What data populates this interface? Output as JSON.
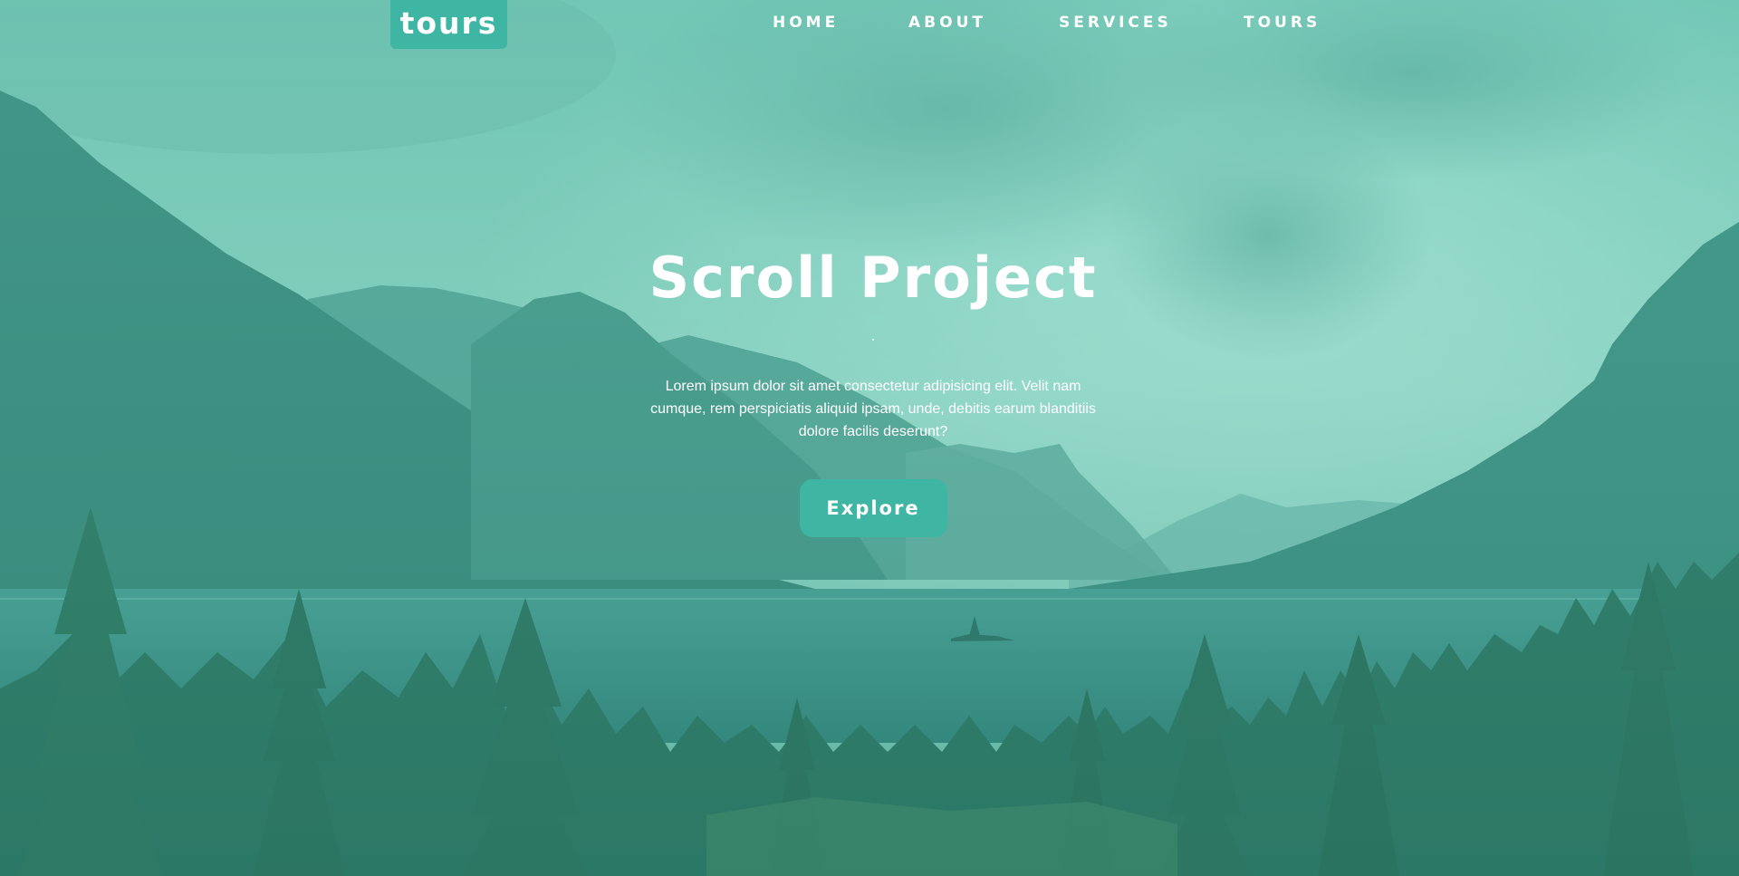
{
  "navbar": {
    "logo": "tours",
    "links": [
      {
        "label": "HOME"
      },
      {
        "label": "ABOUT"
      },
      {
        "label": "SERVICES"
      },
      {
        "label": "TOURS"
      }
    ]
  },
  "banner": {
    "title": "Scroll Project",
    "text": "Lorem ipsum dolor sit amet consectetur adipisicing elit. Velit nam cumque, rem perspiciatis aliquid ipsam, unde, debitis earum blanditiis dolore facilis deserunt?",
    "button_label": "Explore"
  },
  "colors": {
    "accent": "#3fb5a3",
    "overlay": "#56c8b4",
    "text": "#ffffff"
  }
}
